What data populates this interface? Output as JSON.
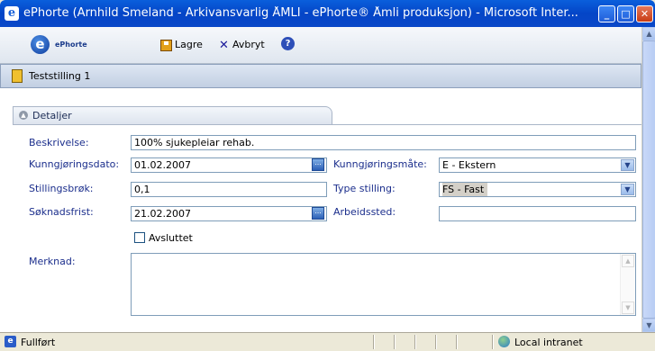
{
  "window": {
    "title": "ePhorte (Arnhild Smeland - Arkivansvarlig ÅMLI - ePhorte® Åmli produksjon) - Microsoft Inter...",
    "controls": {
      "minimize": "_",
      "maximize": "□",
      "close": "✕"
    }
  },
  "toolbar": {
    "logo_text": "ePhorte",
    "save_label": "Lagre",
    "cancel_label": "Avbryt",
    "help_glyph": "?"
  },
  "record": {
    "title": "Teststilling 1"
  },
  "section": {
    "tab_label": "Detaljer"
  },
  "form": {
    "beskrivelse": {
      "label": "Beskrivelse:",
      "value": "100% sjukepleiar rehab."
    },
    "kunngjoringsdato": {
      "label": "Kunngjøringsdato:",
      "value": "01.02.2007"
    },
    "kunngjoringsmate": {
      "label": "Kunngjøringsmåte:",
      "value": "E - Ekstern"
    },
    "stillingsbrok": {
      "label": "Stillingsbrøk:",
      "value": "0,1"
    },
    "type_stilling": {
      "label": "Type stilling:",
      "value": "FS - Fast"
    },
    "soknadsfrist": {
      "label": "Søknadsfrist:",
      "value": "21.02.2007"
    },
    "arbeidssted": {
      "label": "Arbeidssted:",
      "value": ""
    },
    "avsluttet": {
      "label": "Avsluttet",
      "checked": false
    },
    "merknad": {
      "label": "Merknad:",
      "value": ""
    },
    "date_button_glyph": "..."
  },
  "statusbar": {
    "status": "Fullført",
    "zone": "Local intranet"
  },
  "icons": [
    "ie-icon",
    "ephorte-logo-icon",
    "save-icon",
    "cancel-icon",
    "help-icon",
    "document-icon",
    "chevron-up-icon",
    "calendar-icon",
    "dropdown-arrow-icon",
    "globe-icon"
  ]
}
